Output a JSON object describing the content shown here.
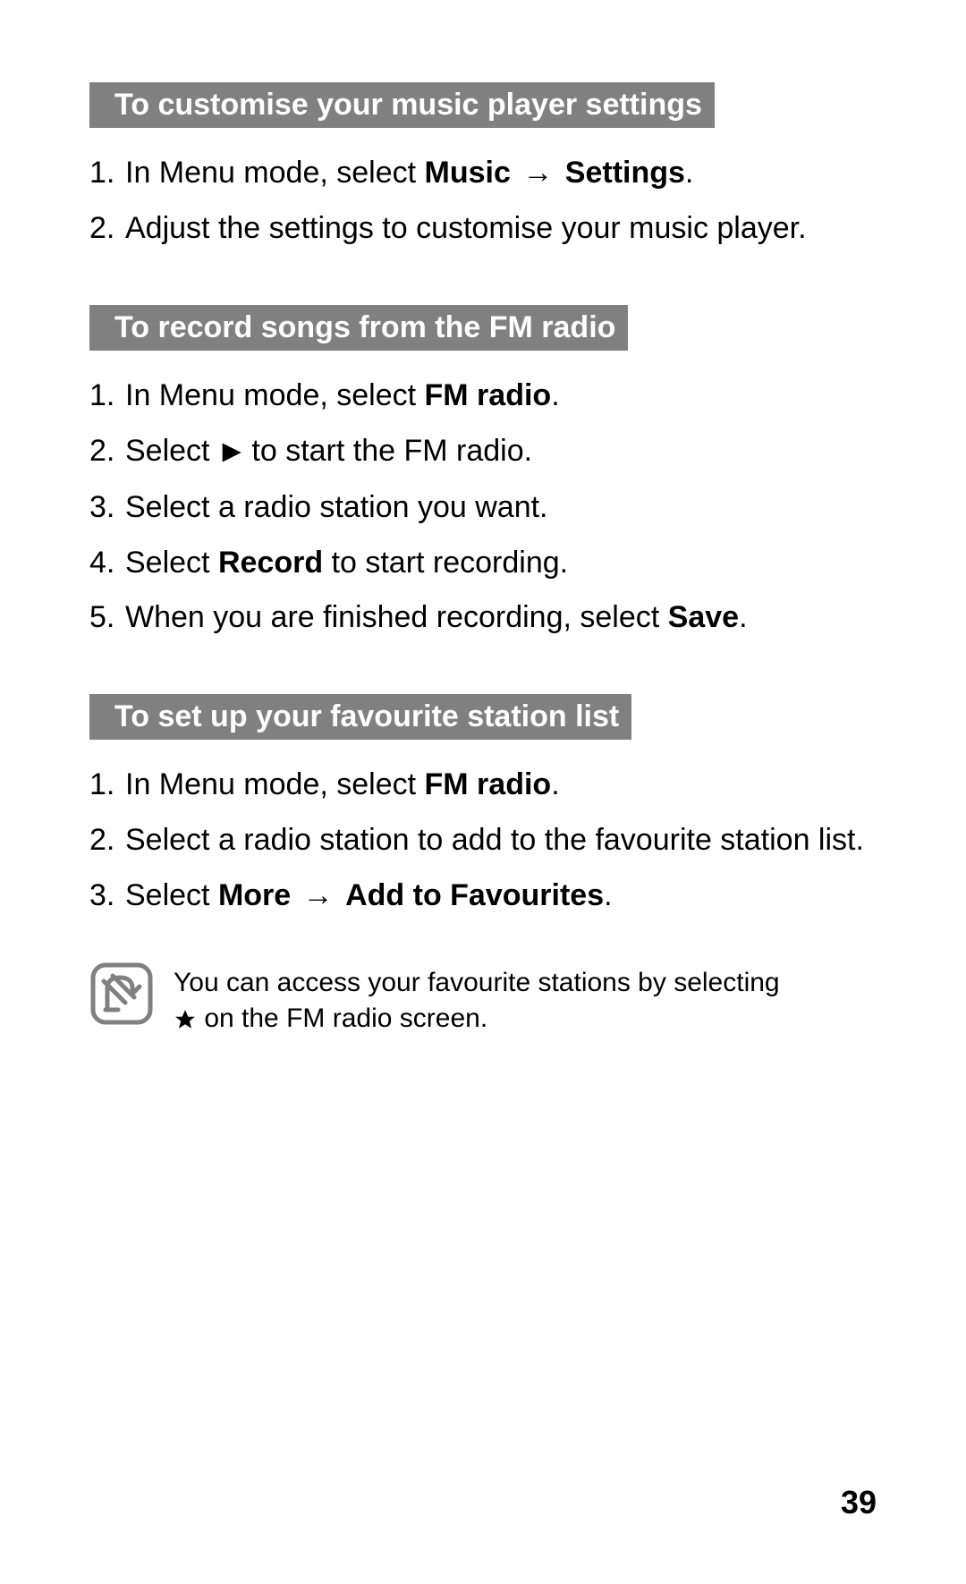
{
  "sections": [
    {
      "heading": "To customise your music player settings",
      "steps": [
        {
          "parts": [
            "In Menu mode, select ",
            {
              "bold": "Music"
            },
            " ",
            {
              "arrow": "→"
            },
            " ",
            {
              "bold": "Settings"
            },
            "."
          ]
        },
        {
          "parts": [
            " Adjust the settings to customise your music player."
          ]
        }
      ]
    },
    {
      "heading": "To record songs from the FM radio",
      "steps": [
        {
          "parts": [
            "In Menu mode, select ",
            {
              "bold": "FM radio"
            },
            "."
          ]
        },
        {
          "parts": [
            "Select ",
            {
              "icon": "play"
            },
            " to start the FM radio."
          ]
        },
        {
          "parts": [
            "Select a radio station you want."
          ]
        },
        {
          "parts": [
            "Select ",
            {
              "bold": "Record"
            },
            " to start recording."
          ]
        },
        {
          "parts": [
            "When you are finished recording, select ",
            {
              "bold": "Save"
            },
            "."
          ]
        }
      ]
    },
    {
      "heading": "To set up your favourite station list",
      "steps": [
        {
          "parts": [
            "In Menu mode, select ",
            {
              "bold": "FM radio"
            },
            "."
          ]
        },
        {
          "parts": [
            "Select a radio station to add to the favourite station list."
          ]
        },
        {
          "parts": [
            "Select ",
            {
              "bold": "More"
            },
            " ",
            {
              "arrow": "→"
            },
            " ",
            {
              "bold": "Add to Favourites"
            },
            "."
          ]
        }
      ],
      "note": {
        "parts": [
          "You can access your favourite stations by selecting ",
          {
            "icon": "star"
          },
          " on the FM radio screen."
        ]
      }
    }
  ],
  "page_number": "39"
}
